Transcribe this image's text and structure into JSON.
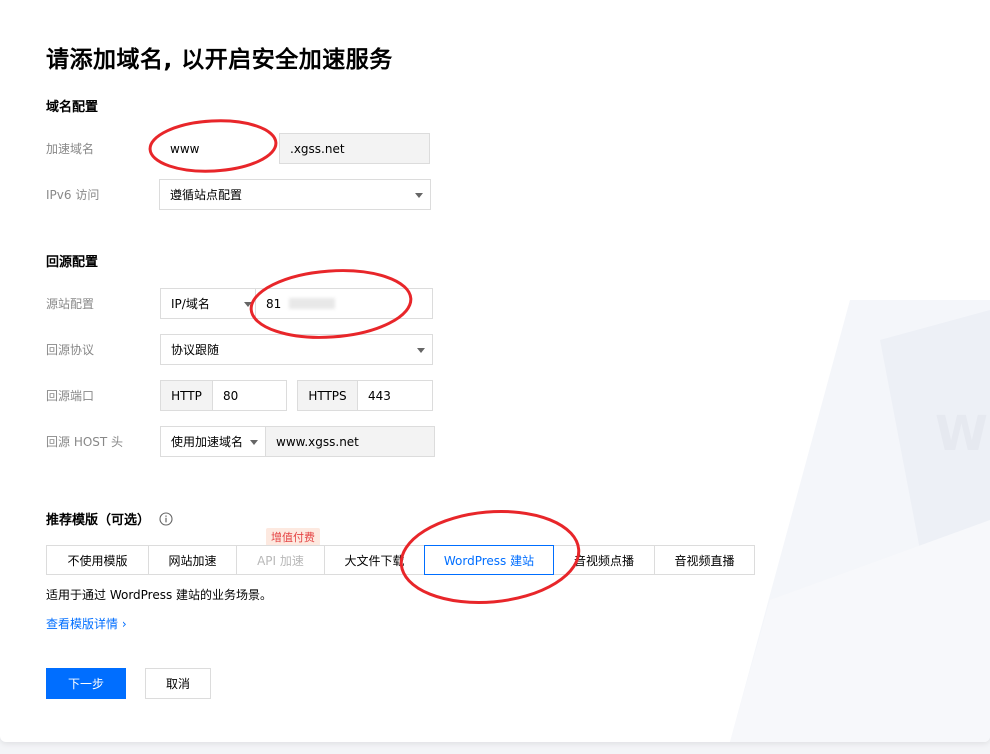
{
  "page": {
    "title": "请添加域名, 以开启安全加速服务"
  },
  "domain_config": {
    "section_title": "域名配置",
    "accel_domain": {
      "label": "加速域名",
      "prefix_value": "www",
      "suffix": ".xgss.net"
    },
    "ipv6": {
      "label": "IPv6 访问",
      "value": "遵循站点配置"
    }
  },
  "origin_config": {
    "section_title": "回源配置",
    "origin": {
      "label": "源站配置",
      "type_value": "IP/域名",
      "address_value": "81"
    },
    "protocol": {
      "label": "回源协议",
      "value": "协议跟随"
    },
    "port": {
      "label": "回源端口",
      "http_label": "HTTP",
      "http_value": "80",
      "https_label": "HTTPS",
      "https_value": "443"
    },
    "host": {
      "label": "回源 HOST 头",
      "mode_value": "使用加速域名",
      "host_value": "www.xgss.net"
    }
  },
  "templates": {
    "section_title": "推荐模版（可选）",
    "paid_badge": "增值付费",
    "tabs": [
      "不使用模版",
      "网站加速",
      "API 加速",
      "大文件下载",
      "WordPress 建站",
      "音视频点播",
      "音视频直播"
    ],
    "description": "适用于通过 WordPress 建站的业务场景。",
    "details_link": "查看模版详情 ›"
  },
  "actions": {
    "next_label": "下一步",
    "cancel_label": "取消"
  },
  "colors": {
    "primary": "#006eff",
    "annotation": "#e8262a",
    "paid_text": "#e54545"
  }
}
